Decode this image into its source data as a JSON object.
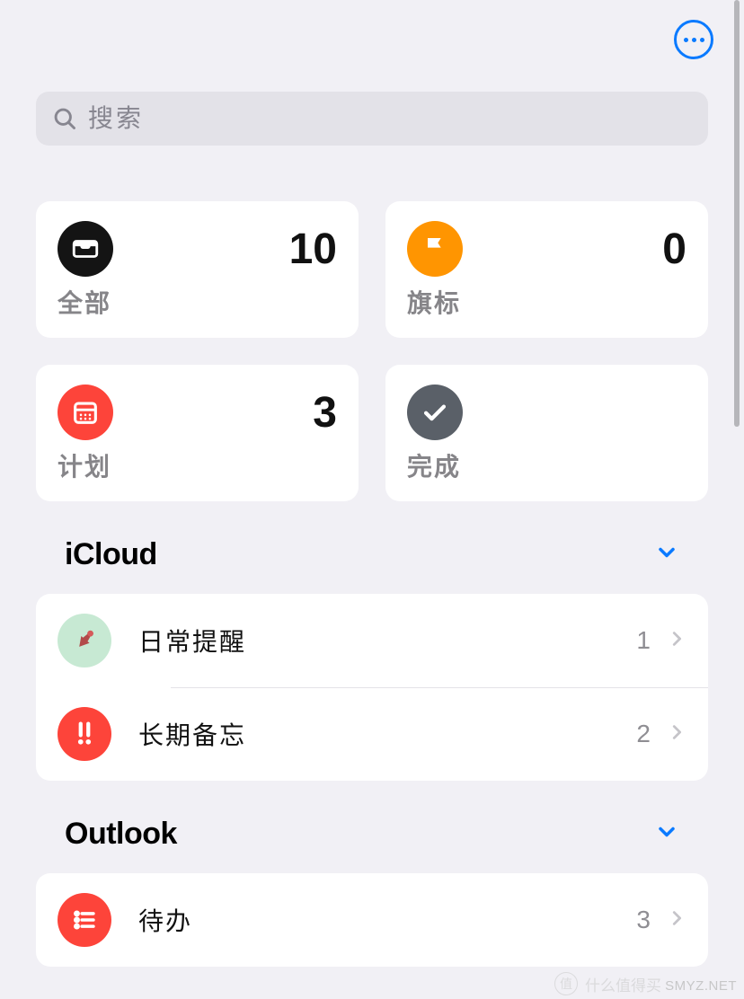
{
  "search": {
    "placeholder": "搜索"
  },
  "cards": {
    "all": {
      "label": "全部",
      "count": "10"
    },
    "flagged": {
      "label": "旗标",
      "count": "0"
    },
    "scheduled": {
      "label": "计划",
      "count": "3"
    },
    "done": {
      "label": "完成",
      "count": ""
    }
  },
  "sections": {
    "icloud": {
      "title": "iCloud",
      "items": [
        {
          "label": "日常提醒",
          "count": "1"
        },
        {
          "label": "长期备忘",
          "count": "2"
        }
      ]
    },
    "outlook": {
      "title": "Outlook",
      "items": [
        {
          "label": "待办",
          "count": "3"
        }
      ]
    }
  },
  "watermark": {
    "site": "SMYZ.NET",
    "zh": "什么值得买"
  }
}
